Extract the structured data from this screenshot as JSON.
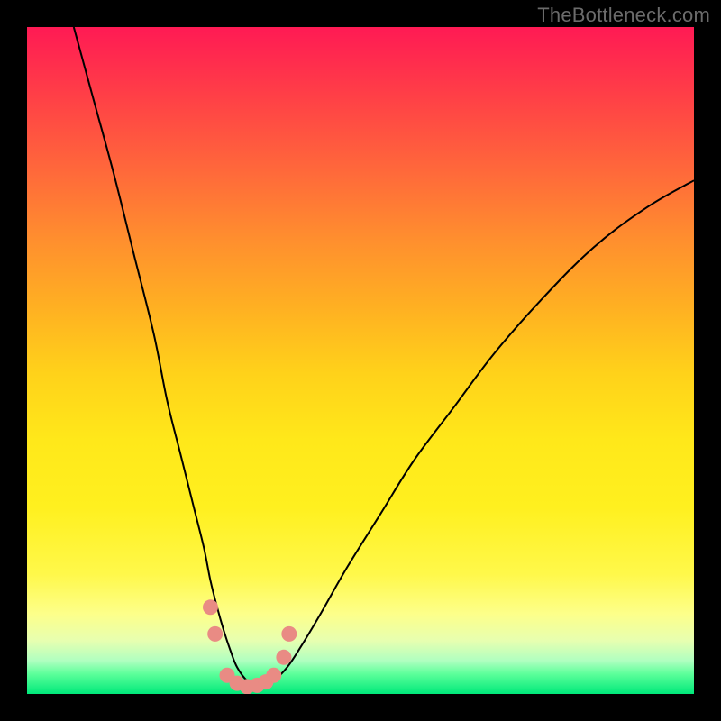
{
  "watermark": "TheBottleneck.com",
  "colors": {
    "frame": "#000000",
    "curve": "#000000",
    "markers": "#e98b84"
  },
  "chart_data": {
    "type": "line",
    "title": "",
    "xlabel": "",
    "ylabel": "",
    "xlim": [
      0,
      100
    ],
    "ylim": [
      0,
      100
    ],
    "series": [
      {
        "name": "left",
        "x": [
          7,
          10,
          13,
          16,
          19,
          21,
          23,
          25,
          26.5,
          27.5,
          28.5,
          29.5,
          30.5,
          31.5,
          33,
          35
        ],
        "y": [
          100,
          89,
          78,
          66,
          54,
          44,
          36,
          28,
          22,
          17,
          13,
          9.5,
          6.5,
          4,
          2,
          1
        ]
      },
      {
        "name": "right",
        "x": [
          35,
          37,
          39,
          41,
          44,
          48,
          53,
          58,
          64,
          70,
          77,
          85,
          93,
          100
        ],
        "y": [
          1,
          2,
          4,
          7,
          12,
          19,
          27,
          35,
          43,
          51,
          59,
          67,
          73,
          77
        ]
      }
    ],
    "valley_markers": {
      "x": [
        27.5,
        28.2,
        30.0,
        31.5,
        33.0,
        34.5,
        35.8,
        37.0,
        38.5,
        39.3
      ],
      "y": [
        13.0,
        9.0,
        2.8,
        1.6,
        1.1,
        1.3,
        1.8,
        2.8,
        5.5,
        9.0
      ]
    },
    "annotations": []
  }
}
